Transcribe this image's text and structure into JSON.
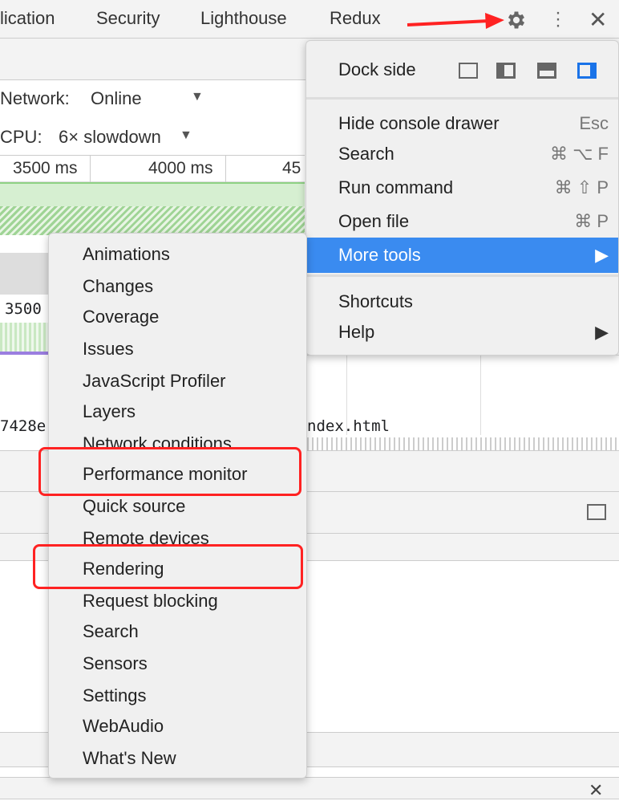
{
  "tabs": [
    "lication",
    "Security",
    "Lighthouse",
    "Redux"
  ],
  "toolbar": {
    "network_label": "Network:",
    "network_value": "Online",
    "cpu_label": "CPU:",
    "cpu_value": "6× slowdown"
  },
  "ruler": [
    "3500 ms",
    "4000 ms",
    "45"
  ],
  "lower": {
    "time": "3500",
    "file_left": "7428e",
    "file_right": "ndex.html"
  },
  "main_menu": {
    "dock_side": "Dock side",
    "items": [
      {
        "label": "Hide console drawer",
        "shortcut": "Esc"
      },
      {
        "label": "Search",
        "shortcut": "⌘ ⌥ F"
      },
      {
        "label": "Run command",
        "shortcut": "⌘ ⇧ P"
      },
      {
        "label": "Open file",
        "shortcut": "⌘ P"
      },
      {
        "label": "More tools",
        "shortcut": "▶"
      },
      {
        "label": "Shortcuts",
        "shortcut": ""
      },
      {
        "label": "Help",
        "shortcut": "▶"
      }
    ]
  },
  "more_tools": [
    "Animations",
    "Changes",
    "Coverage",
    "Issues",
    "JavaScript Profiler",
    "Layers",
    "Network conditions",
    "Performance monitor",
    "Quick source",
    "Remote devices",
    "Rendering",
    "Request blocking",
    "Search",
    "Sensors",
    "Settings",
    "WebAudio",
    "What's New"
  ],
  "colors": {
    "highlight": "#3a8bf0",
    "annotation": "#f22222"
  }
}
